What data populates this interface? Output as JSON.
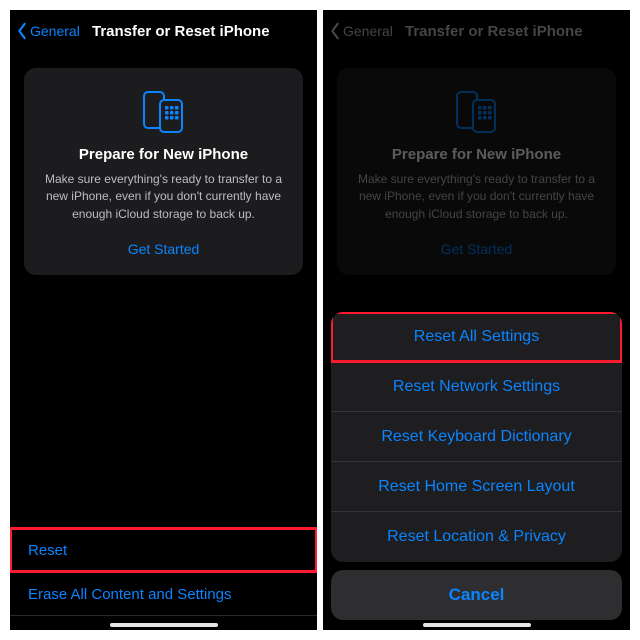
{
  "colors": {
    "accent": "#0a84ff",
    "highlight": "#ff1a2f"
  },
  "left": {
    "nav": {
      "back_label": "General",
      "title": "Transfer or Reset iPhone"
    },
    "card": {
      "heading": "Prepare for New iPhone",
      "body": "Make sure everything's ready to transfer to a new iPhone, even if you don't currently have enough iCloud storage to back up.",
      "cta": "Get Started"
    },
    "rows": {
      "reset": "Reset",
      "erase": "Erase All Content and Settings"
    }
  },
  "right": {
    "nav": {
      "back_label": "General",
      "title": "Transfer or Reset iPhone"
    },
    "card": {
      "heading": "Prepare for New iPhone",
      "body": "Make sure everything's ready to transfer to a new iPhone, even if you don't currently have enough iCloud storage to back up.",
      "cta": "Get Started"
    },
    "sheet": {
      "options": [
        "Reset All Settings",
        "Reset Network Settings",
        "Reset Keyboard Dictionary",
        "Reset Home Screen Layout",
        "Reset Location & Privacy"
      ],
      "cancel": "Cancel"
    }
  }
}
